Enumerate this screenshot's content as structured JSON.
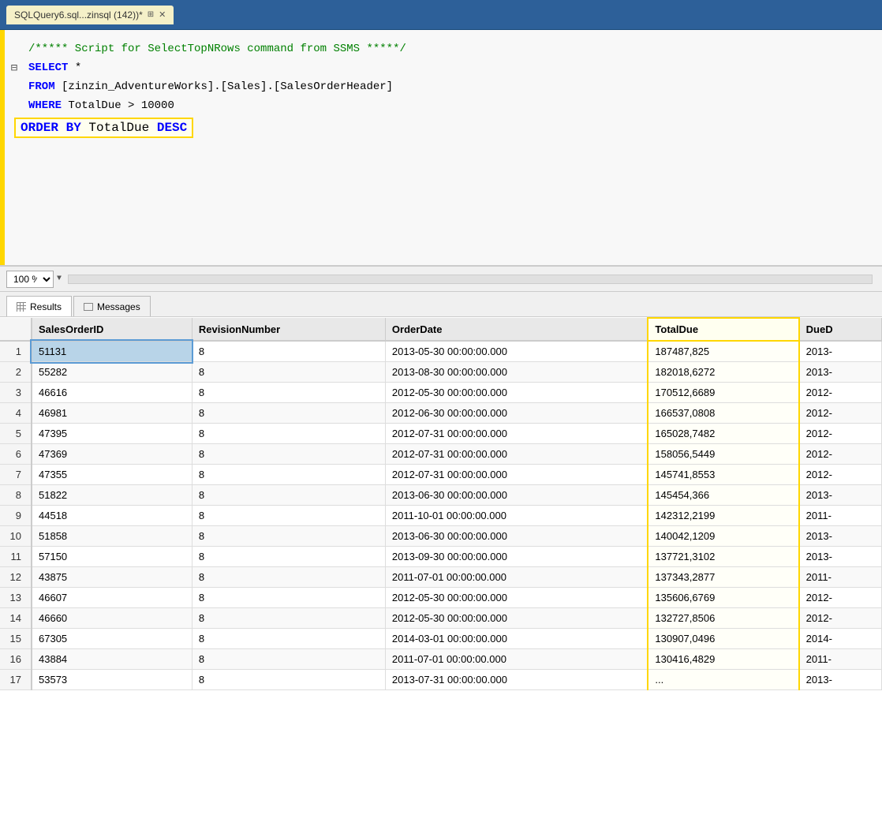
{
  "titleBar": {
    "tabLabel": "SQLQuery6.sql...zinsql (142))*",
    "pinIcon": "📌",
    "closeIcon": "✕"
  },
  "editor": {
    "comment": "/***** Script for SelectTopNRows command from SSMS  *****/",
    "line1": "SELECT *",
    "line2": "FROM [zinzin_AdventureWorks].[Sales].[SalesOrderHeader]",
    "line3": "WHERE TotalDue > 10000",
    "line4": "ORDER BY TotalDue DESC"
  },
  "zoom": {
    "level": "100 %"
  },
  "tabs": {
    "results": "Results",
    "messages": "Messages"
  },
  "table": {
    "columns": [
      "SalesOrderID",
      "RevisionNumber",
      "OrderDate",
      "TotalDue",
      "DueD"
    ],
    "rows": [
      {
        "num": "1",
        "salesOrderID": "51131",
        "revisionNumber": "8",
        "orderDate": "2013-05-30 00:00:00.000",
        "totalDue": "187487,825",
        "dueD": "2013-"
      },
      {
        "num": "2",
        "salesOrderID": "55282",
        "revisionNumber": "8",
        "orderDate": "2013-08-30 00:00:00.000",
        "totalDue": "182018,6272",
        "dueD": "2013-"
      },
      {
        "num": "3",
        "salesOrderID": "46616",
        "revisionNumber": "8",
        "orderDate": "2012-05-30 00:00:00.000",
        "totalDue": "170512,6689",
        "dueD": "2012-"
      },
      {
        "num": "4",
        "salesOrderID": "46981",
        "revisionNumber": "8",
        "orderDate": "2012-06-30 00:00:00.000",
        "totalDue": "166537,0808",
        "dueD": "2012-"
      },
      {
        "num": "5",
        "salesOrderID": "47395",
        "revisionNumber": "8",
        "orderDate": "2012-07-31 00:00:00.000",
        "totalDue": "165028,7482",
        "dueD": "2012-"
      },
      {
        "num": "6",
        "salesOrderID": "47369",
        "revisionNumber": "8",
        "orderDate": "2012-07-31 00:00:00.000",
        "totalDue": "158056,5449",
        "dueD": "2012-"
      },
      {
        "num": "7",
        "salesOrderID": "47355",
        "revisionNumber": "8",
        "orderDate": "2012-07-31 00:00:00.000",
        "totalDue": "145741,8553",
        "dueD": "2012-"
      },
      {
        "num": "8",
        "salesOrderID": "51822",
        "revisionNumber": "8",
        "orderDate": "2013-06-30 00:00:00.000",
        "totalDue": "145454,366",
        "dueD": "2013-"
      },
      {
        "num": "9",
        "salesOrderID": "44518",
        "revisionNumber": "8",
        "orderDate": "2011-10-01 00:00:00.000",
        "totalDue": "142312,2199",
        "dueD": "2011-"
      },
      {
        "num": "10",
        "salesOrderID": "51858",
        "revisionNumber": "8",
        "orderDate": "2013-06-30 00:00:00.000",
        "totalDue": "140042,1209",
        "dueD": "2013-"
      },
      {
        "num": "11",
        "salesOrderID": "57150",
        "revisionNumber": "8",
        "orderDate": "2013-09-30 00:00:00.000",
        "totalDue": "137721,3102",
        "dueD": "2013-"
      },
      {
        "num": "12",
        "salesOrderID": "43875",
        "revisionNumber": "8",
        "orderDate": "2011-07-01 00:00:00.000",
        "totalDue": "137343,2877",
        "dueD": "2011-"
      },
      {
        "num": "13",
        "salesOrderID": "46607",
        "revisionNumber": "8",
        "orderDate": "2012-05-30 00:00:00.000",
        "totalDue": "135606,6769",
        "dueD": "2012-"
      },
      {
        "num": "14",
        "salesOrderID": "46660",
        "revisionNumber": "8",
        "orderDate": "2012-05-30 00:00:00.000",
        "totalDue": "132727,8506",
        "dueD": "2012-"
      },
      {
        "num": "15",
        "salesOrderID": "67305",
        "revisionNumber": "8",
        "orderDate": "2014-03-01 00:00:00.000",
        "totalDue": "130907,0496",
        "dueD": "2014-"
      },
      {
        "num": "16",
        "salesOrderID": "43884",
        "revisionNumber": "8",
        "orderDate": "2011-07-01 00:00:00.000",
        "totalDue": "130416,4829",
        "dueD": "2011-"
      },
      {
        "num": "17",
        "salesOrderID": "53573",
        "revisionNumber": "8",
        "orderDate": "2013-07-31 00:00:00.000",
        "totalDue": "...",
        "dueD": "2013-"
      }
    ]
  }
}
